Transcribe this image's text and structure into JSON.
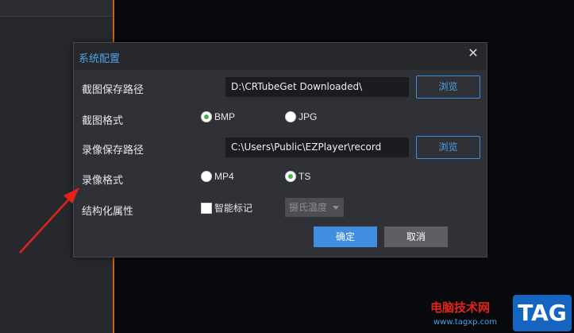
{
  "dialog": {
    "title": "系统配置",
    "close_glyph": "✕",
    "snapshot_path": {
      "label": "截图保存路径",
      "value": "D:\\CRTubeGet Downloaded\\",
      "browse_label": "浏览"
    },
    "snapshot_format": {
      "label": "截图格式",
      "options": [
        "BMP",
        "JPG"
      ],
      "selected": "BMP"
    },
    "record_path": {
      "label": "录像保存路径",
      "value": "C:\\Users\\Public\\EZPlayer\\record",
      "browse_label": "浏览"
    },
    "record_format": {
      "label": "录像格式",
      "options": [
        "MP4",
        "TS"
      ],
      "selected": "TS"
    },
    "structured": {
      "label": "结构化属性",
      "checkbox_label": "智能标记",
      "checked": false,
      "select_value": "摄氏温度"
    },
    "ok_label": "确定",
    "cancel_label": "取消"
  },
  "colors": {
    "accent": "#3f8ee0",
    "title": "#4fa3e6",
    "radio_checked": "#4caf50",
    "annotation_arrow": "#e2231a",
    "orange_line": "#c2650f"
  },
  "watermark": {
    "text": "电脑技术网",
    "url": "www.tagxp.com",
    "logo": "TAG"
  }
}
